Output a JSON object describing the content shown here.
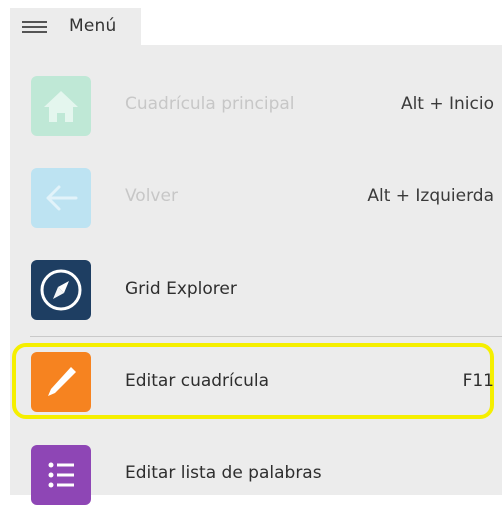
{
  "menu": {
    "title": "Menú"
  },
  "items": [
    {
      "label": "Cuadrícula principal",
      "shortcut": "Alt + Inicio",
      "icon": "home-icon",
      "color": "#bfe8d6",
      "enabled": false
    },
    {
      "label": "Volver",
      "shortcut": "Alt + Izquierda",
      "icon": "arrow-left-icon",
      "color": "#bde3f2",
      "enabled": false
    },
    {
      "label": "Grid Explorer",
      "shortcut": "",
      "icon": "compass-icon",
      "color": "#1e3e62",
      "enabled": true
    },
    {
      "label": "Editar cuadrícula",
      "shortcut": "F11",
      "icon": "pencil-icon",
      "color": "#f68320",
      "enabled": true,
      "highlighted": true
    },
    {
      "label": "Editar lista de palabras",
      "shortcut": "",
      "icon": "list-icon",
      "color": "#8e46b5",
      "enabled": true
    }
  ],
  "highlight_color": "#f5ef00"
}
